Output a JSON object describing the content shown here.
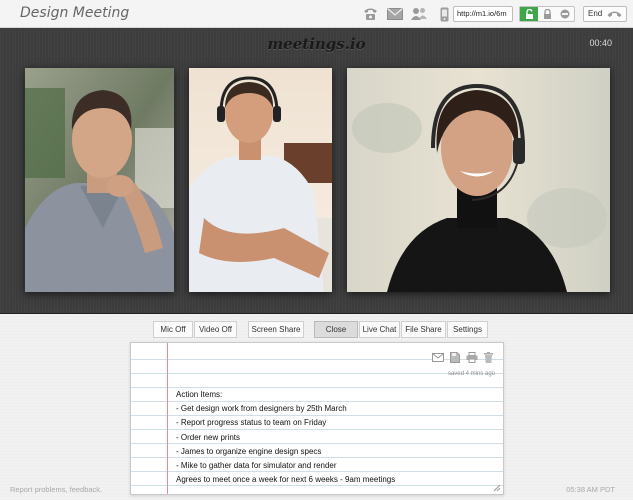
{
  "window": {
    "title": "Design Meeting"
  },
  "topbar": {
    "icons": [
      "phone-icon",
      "mail-icon",
      "people-icon",
      "mobile-icon"
    ],
    "url": "http://m1.io/6m",
    "lock_controls": [
      "unlock-icon",
      "lock-icon",
      "block-icon"
    ],
    "active_lock": "unlock-icon",
    "end_label": "End",
    "accent": "#3fa64a"
  },
  "stage": {
    "brand": "meetings.io",
    "timer": "00:40",
    "participants": [
      "participant-1",
      "participant-2",
      "participant-3"
    ]
  },
  "toolbar": {
    "mic": "Mic Off",
    "video": "Video Off",
    "screen_share": "Screen Share",
    "close": "Close",
    "live_chat": "Live Chat",
    "file_share": "File Share",
    "settings": "Settings"
  },
  "notes": {
    "tools": [
      "mail-icon",
      "save-icon",
      "print-icon",
      "trash-icon"
    ],
    "saved": "saved 4 mins ago",
    "lines": [
      "Action Items:",
      "- Get design work from designers by 25th March",
      "- Report progress status to team on Friday",
      "- Order new prints",
      "- James to organize engine design specs",
      "- Mike to gather data for simulator and render",
      "Agrees to meet once a week for next 6 weeks - 9am meetings"
    ]
  },
  "footer": {
    "report": "Report problems, feedback.",
    "clock": "05:38 AM PDT"
  }
}
